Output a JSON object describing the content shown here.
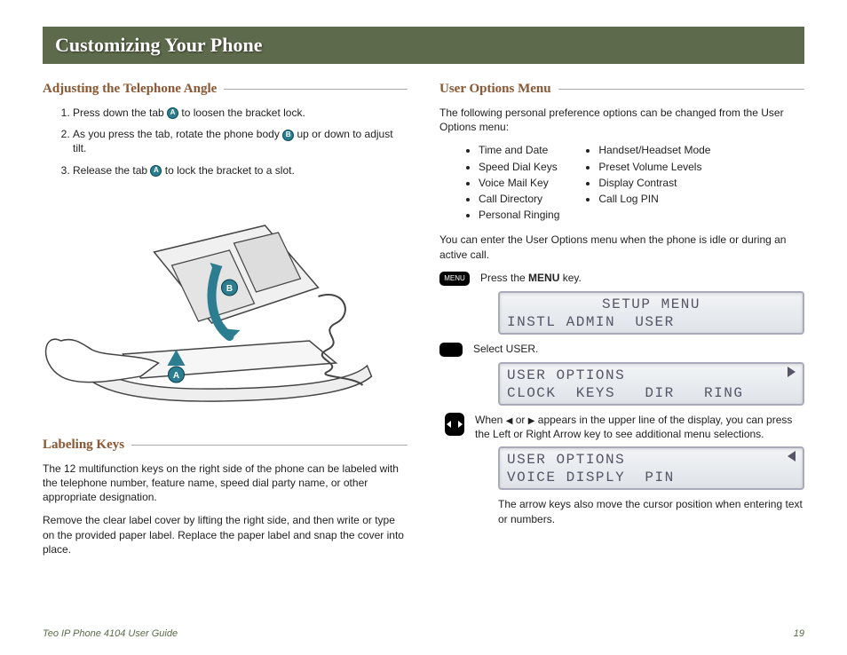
{
  "page": {
    "title": "Customizing Your Phone",
    "footer_left": "Teo IP Phone 4104 User Guide",
    "footer_right": "19"
  },
  "left": {
    "adjusting": {
      "heading": "Adjusting the Telephone Angle",
      "step1_a": "Press down the tab ",
      "step1_b": " to loosen the bracket lock.",
      "step2_a": "As you press the tab, rotate the phone body ",
      "step2_b": " up or down to adjust tilt.",
      "step3_a": "Release the tab ",
      "step3_b": " to lock the bracket to a slot.",
      "badge_a": "A",
      "badge_b": "B"
    },
    "labeling": {
      "heading": "Labeling Keys",
      "p1": "The 12 multifunction keys on the right side of the phone can be labeled with the telephone number, feature name, speed dial party name, or other appropriate designation.",
      "p2": "Remove the clear label cover by lifting the right side, and then write or type on the provided paper label. Replace the paper label and snap the cover into place."
    }
  },
  "right": {
    "heading": "User Options Menu",
    "intro": "The following personal preference options can be changed from the User Options menu:",
    "opts_col1": [
      "Time and Date",
      "Speed Dial Keys",
      "Voice Mail Key",
      "Call Directory",
      "Personal Ringing"
    ],
    "opts_col2": [
      "Handset/Headset Mode",
      "Preset Volume Levels",
      "Display Contrast",
      "Call Log PIN"
    ],
    "enter_note": "You can enter the User Options menu when the phone is idle or during an active call.",
    "menu_key_label": "MENU",
    "press_menu_a": "Press the ",
    "press_menu_b": "MENU",
    "press_menu_c": " key.",
    "lcd1_line1": "SETUP MENU",
    "lcd1_line2": "INSTL ADMIN  USER",
    "select_user": "Select USER.",
    "lcd2_line1": "USER OPTIONS",
    "lcd2_line2": "CLOCK  KEYS   DIR   RING",
    "arrows_a": "When ",
    "arrows_b": " or ",
    "arrows_c": " appears in the upper line of the display, you can press the Left or Right Arrow key to see additional menu selections.",
    "lcd3_line1": "USER OPTIONS",
    "lcd3_line2": "VOICE DISPLY  PIN",
    "cursor_note": "The arrow keys also move the cursor position when entering text or numbers."
  }
}
